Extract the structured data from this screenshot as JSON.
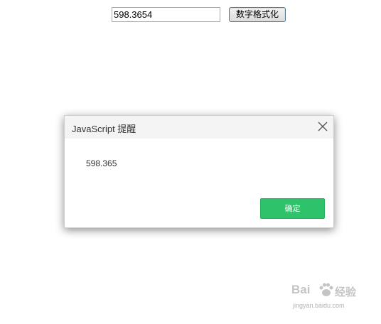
{
  "form": {
    "input_value": "598.3654",
    "format_button_label": "数字格式化"
  },
  "dialog": {
    "title": "JavaScript 提醒",
    "message": "598.365",
    "ok_label": "确定"
  },
  "watermark": {
    "logo_text_left": "Bai",
    "logo_text_right": "经验",
    "url_text": "jingyan.baidu.com"
  },
  "colors": {
    "ok_button": "#2ec36a",
    "dialog_header": "#f4f4f4"
  }
}
